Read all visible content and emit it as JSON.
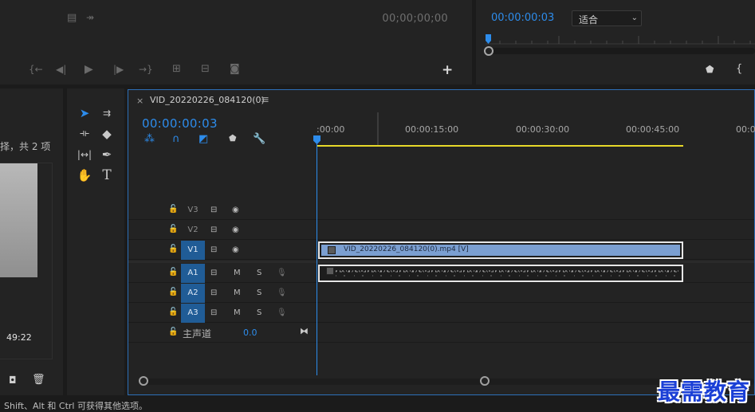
{
  "source_monitor": {
    "timecode": "00;00;00;00",
    "controls": [
      "mark-in-icon",
      "step-back-icon",
      "play-icon",
      "step-forward-icon",
      "mark-out-icon",
      "insert-icon",
      "overwrite-icon",
      "camera-icon",
      "add-icon"
    ]
  },
  "program_monitor": {
    "timecode": "00:00:00:03",
    "fit_value": "适合"
  },
  "project": {
    "count_text": "择，共 2 项",
    "clip_duration": "49:22"
  },
  "timeline": {
    "tab_title": "VID_20220226_084120(0)",
    "timecode": "00:00:00:03",
    "ruler_labels": [
      ":00:00",
      "00:00:15:00",
      "00:00:30:00",
      "00:00:45:00",
      "00:0"
    ],
    "video_tracks": [
      {
        "name": "V3",
        "active": false
      },
      {
        "name": "V2",
        "active": false
      },
      {
        "name": "V1",
        "active": true
      }
    ],
    "audio_tracks": [
      {
        "name": "A1",
        "m": "M",
        "s": "S"
      },
      {
        "name": "A2",
        "m": "M",
        "s": "S"
      },
      {
        "name": "A3",
        "m": "M",
        "s": "S"
      }
    ],
    "master_label": "主声道",
    "master_volume": "0.0",
    "video_clip_label": "VID_20220226_084120(0).mp4 [V]"
  },
  "status_bar": {
    "text": "Shift、Alt 和 Ctrl 可获得其他选项。"
  },
  "watermark": "最需教育",
  "colors": {
    "accent": "#2d8ceb",
    "track_active": "#205c96",
    "video_clip": "#7b9fd1",
    "work_area": "#e7d929"
  }
}
